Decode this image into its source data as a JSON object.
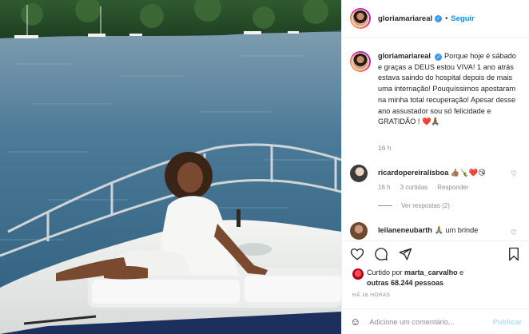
{
  "header": {
    "username": "gloriamariareal",
    "separator": "•",
    "follow_label": "Seguir"
  },
  "caption": {
    "username": "gloriamariareal",
    "text": "Porque hoje é sábado e graças a DEUS estou VIVA! 1 ano atrás estava saindo do hospital depois de mais uma internação! Pouquíssimos apostaram na minha total recuperação! Apesar desse ano assustador sou só felicidade e GRATIDÃO ! ❤️🙏🏾",
    "time": "16 h"
  },
  "comments": [
    {
      "username": "ricardopereiralisboa",
      "text": "👍🏽🍾❤️😘",
      "time": "16 h",
      "likes": "3 curtidas",
      "reply_label": "Responder",
      "view_replies": "Ver respostas (2)"
    },
    {
      "username": "leilaneneubarth",
      "text": "🙏🏽 um brinde"
    }
  ],
  "likes": {
    "prefix": "Curtido por",
    "user": "marta_carvalho",
    "connector": "e",
    "others": "outras 68.244 pessoas"
  },
  "posted_ago": "HÁ 16 HORAS",
  "comment_box": {
    "placeholder": "Adicione um comentário...",
    "publish_label": "Publicar"
  },
  "icons": {
    "verified": "verified-badge-icon",
    "like": "heart-icon",
    "comment": "comment-icon",
    "share": "share-icon",
    "save": "bookmark-icon",
    "emoji": "emoji-icon"
  },
  "colors": {
    "accent": "#0095f6",
    "verified": "#3897f0",
    "muted": "#8e8e8e",
    "text": "#262626",
    "publish_disabled": "#b2dffc"
  }
}
